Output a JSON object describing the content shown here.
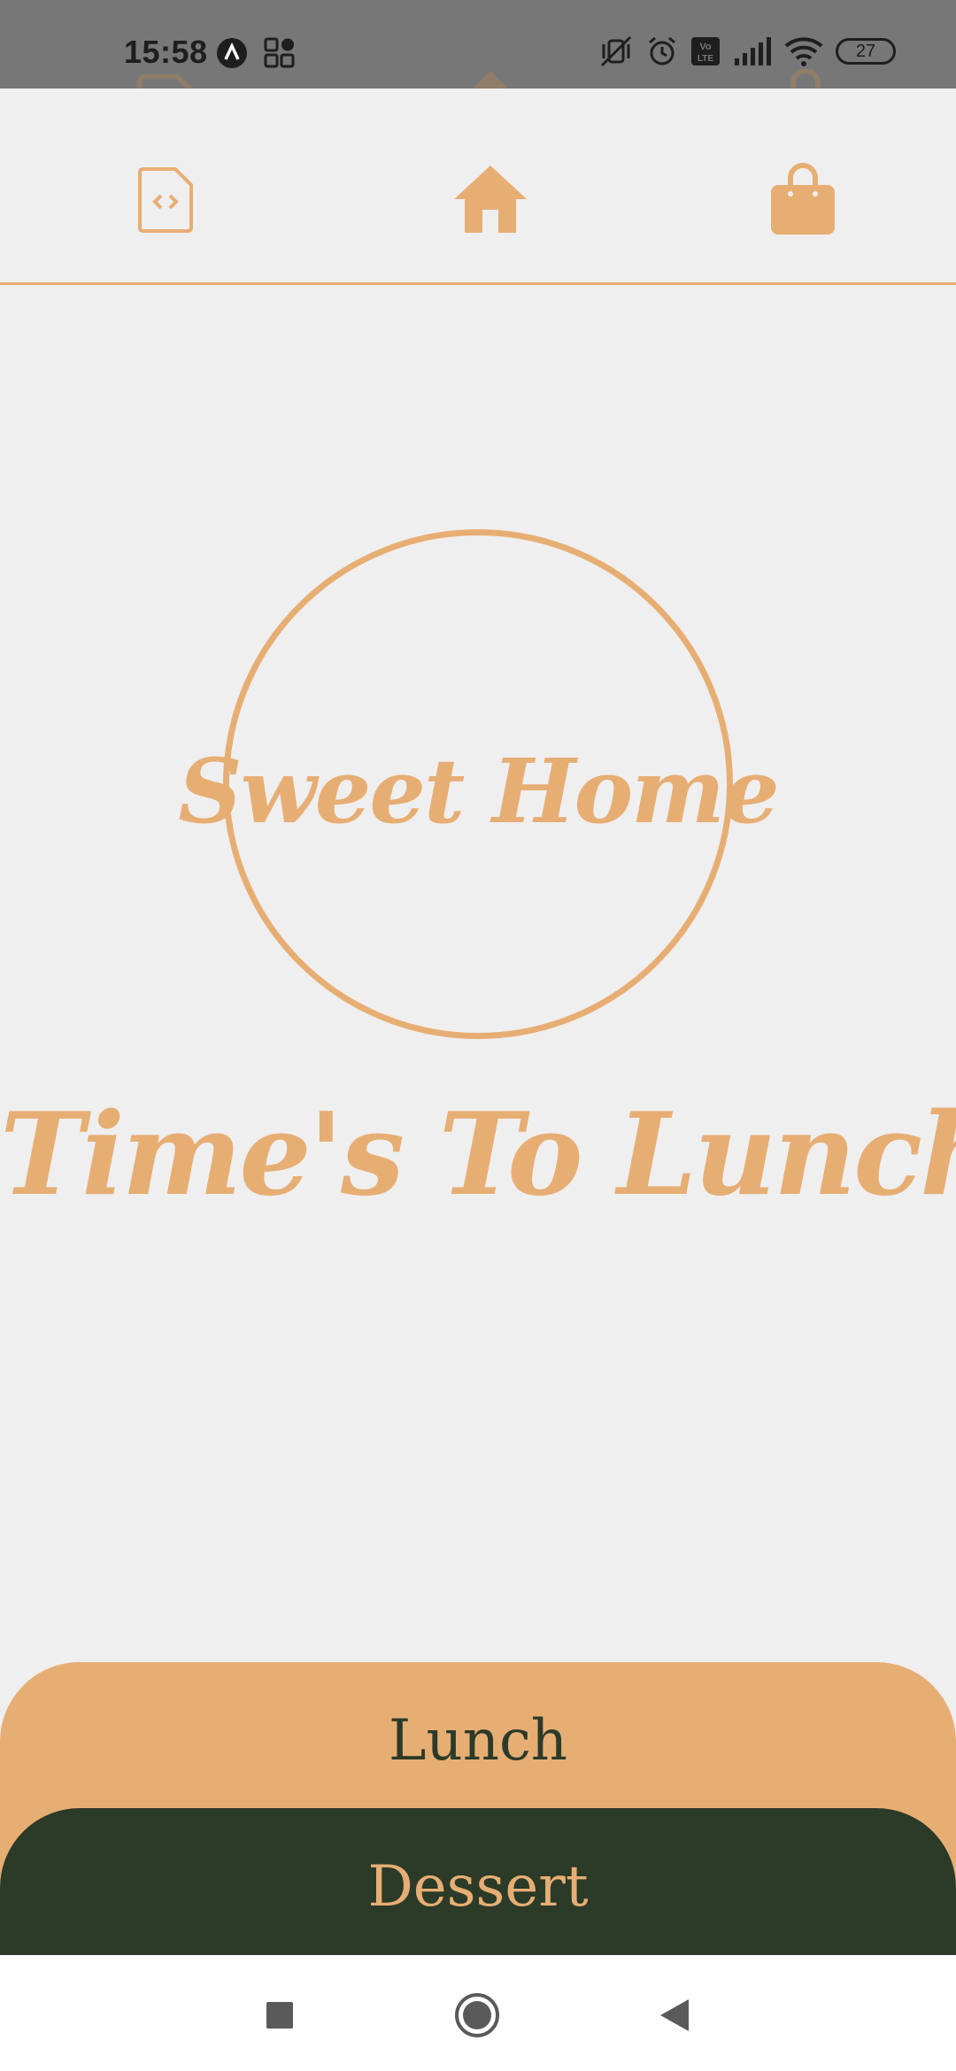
{
  "status_bar": {
    "time": "15:58",
    "battery": "27",
    "icons_left": [
      "a-circle-icon",
      "grid-apps-icon"
    ],
    "icons_right": [
      "vibrate-off-icon",
      "alarm-icon",
      "volte-icon",
      "signal-icon",
      "wifi-icon",
      "battery-icon"
    ]
  },
  "header": {
    "left_icon": "code-file-icon",
    "center_icon": "home-icon",
    "right_icon": "shopping-bag-icon"
  },
  "hero": {
    "logo_text": "Sweet Home",
    "tagline": "Time's To Lunch"
  },
  "tabs": {
    "lunch_label": "Lunch",
    "dessert_label": "Dessert"
  },
  "nav": {
    "recents": "square-icon",
    "home": "circle-icon",
    "back": "triangle-back-icon"
  },
  "colors": {
    "accent": "#e7ae74",
    "dark": "#2c3a28",
    "background": "#f0efef",
    "status_bar": "#777777"
  }
}
